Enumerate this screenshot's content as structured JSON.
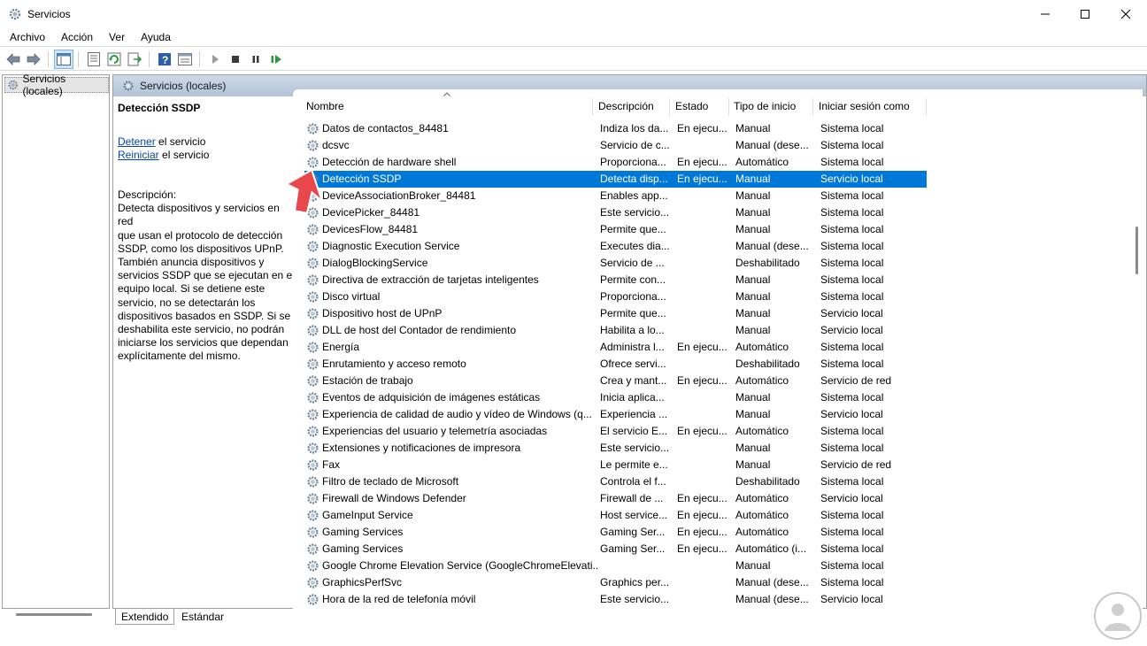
{
  "window": {
    "title": "Servicios"
  },
  "menu": [
    "Archivo",
    "Acción",
    "Ver",
    "Ayuda"
  ],
  "tree": {
    "root": "Servicios (locales)"
  },
  "pane": {
    "header": "Servicios (locales)"
  },
  "details": {
    "title": "Detección SSDP",
    "stop_link": "Detener",
    "stop_suffix": " el servicio",
    "restart_link": "Reiniciar",
    "restart_suffix": " el servicio",
    "desc_label": "Descripción:",
    "desc_lines": [
      "Detecta dispositivos y servicios en red",
      "que usan el protocolo de detección",
      "SSDP, como los dispositivos UPnP.",
      "También anuncia dispositivos y",
      "servicios SSDP que se ejecutan en el",
      "equipo local. Si se detiene este",
      "servicio, no se detectarán los",
      "dispositivos basados en SSDP. Si se",
      "deshabilita este servicio, no podrán",
      "iniciarse los servicios que dependan",
      "explícitamente del mismo."
    ]
  },
  "columns": [
    "Nombre",
    "Descripción",
    "Estado",
    "Tipo de inicio",
    "Iniciar sesión como"
  ],
  "rows": [
    [
      "Datos de contactos_84481",
      "Indiza los da...",
      "En ejecu...",
      "Manual",
      "Sistema local"
    ],
    [
      "dcsvc",
      "Servicio de c...",
      "",
      "Manual (dese...",
      "Sistema local"
    ],
    [
      "Detección de hardware shell",
      "Proporciona...",
      "En ejecu...",
      "Automático",
      "Sistema local"
    ],
    [
      "Detección SSDP",
      "Detecta disp...",
      "En ejecu...",
      "Manual",
      "Servicio local"
    ],
    [
      "DeviceAssociationBroker_84481",
      "Enables app...",
      "",
      "Manual",
      "Sistema local"
    ],
    [
      "DevicePicker_84481",
      "Este servicio...",
      "",
      "Manual",
      "Sistema local"
    ],
    [
      "DevicesFlow_84481",
      "Permite que...",
      "",
      "Manual",
      "Sistema local"
    ],
    [
      "Diagnostic Execution Service",
      "Executes dia...",
      "",
      "Manual (dese...",
      "Sistema local"
    ],
    [
      "DialogBlockingService",
      "Servicio de ...",
      "",
      "Deshabilitado",
      "Sistema local"
    ],
    [
      "Directiva de extracción de tarjetas inteligentes",
      "Permite con...",
      "",
      "Manual",
      "Sistema local"
    ],
    [
      "Disco virtual",
      "Proporciona...",
      "",
      "Manual",
      "Sistema local"
    ],
    [
      "Dispositivo host de UPnP",
      "Permite que...",
      "",
      "Manual",
      "Servicio local"
    ],
    [
      "DLL de host del Contador de rendimiento",
      "Habilita a lo...",
      "",
      "Manual",
      "Servicio local"
    ],
    [
      "Energía",
      "Administra l...",
      "En ejecu...",
      "Automático",
      "Sistema local"
    ],
    [
      "Enrutamiento y acceso remoto",
      "Ofrece servi...",
      "",
      "Deshabilitado",
      "Sistema local"
    ],
    [
      "Estación de trabajo",
      "Crea y mant...",
      "En ejecu...",
      "Automático",
      "Servicio de red"
    ],
    [
      "Eventos de adquisición de imágenes estáticas",
      "Inicia aplica...",
      "",
      "Manual",
      "Sistema local"
    ],
    [
      "Experiencia de calidad de audio y vídeo de Windows (q...",
      "Experiencia ...",
      "",
      "Manual",
      "Servicio local"
    ],
    [
      "Experiencias del usuario y telemetría asociadas",
      "El servicio E...",
      "En ejecu...",
      "Automático",
      "Sistema local"
    ],
    [
      "Extensiones y notificaciones de impresora",
      "Este servicio...",
      "",
      "Manual",
      "Sistema local"
    ],
    [
      "Fax",
      "Le permite e...",
      "",
      "Manual",
      "Servicio de red"
    ],
    [
      "Filtro de teclado de Microsoft",
      "Controla el f...",
      "",
      "Deshabilitado",
      "Sistema local"
    ],
    [
      "Firewall de Windows Defender",
      "Firewall de ...",
      "En ejecu...",
      "Automático",
      "Servicio local"
    ],
    [
      "GameInput Service",
      "Host service...",
      "En ejecu...",
      "Automático",
      "Sistema local"
    ],
    [
      "Gaming Services",
      "Gaming Ser...",
      "En ejecu...",
      "Automático",
      "Sistema local"
    ],
    [
      "Gaming Services",
      "Gaming Ser...",
      "En ejecu...",
      "Automático (i...",
      "Sistema local"
    ],
    [
      "Google Chrome Elevation Service (GoogleChromeElevati...",
      "",
      "",
      "Manual",
      "Sistema local"
    ],
    [
      "GraphicsPerfSvc",
      "Graphics per...",
      "",
      "Manual (dese...",
      "Sistema local"
    ],
    [
      "Hora de la red de telefonía móvil",
      "Este servicio...",
      "",
      "Manual (dese...",
      "Servicio local"
    ]
  ],
  "selected_index": 3,
  "tabs": [
    "Extendido",
    "Estándar"
  ],
  "colors": {
    "selection": "#0078d7",
    "header_band": "#b9c9db",
    "arrow": "#e8474c"
  }
}
